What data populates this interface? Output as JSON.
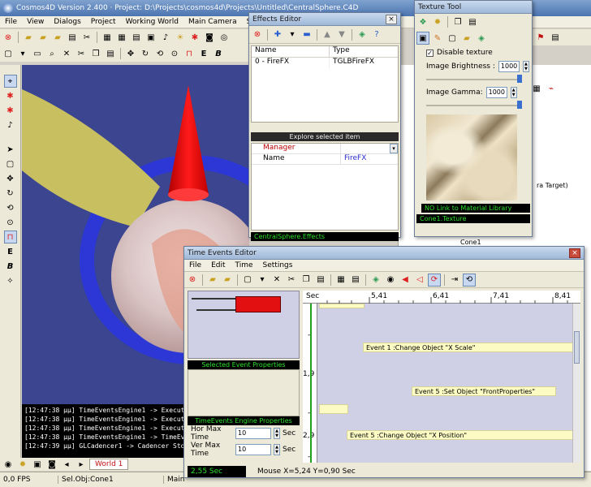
{
  "main": {
    "title": "Cosmos4D Version 2.400 · Project: D:\\Projects\\cosmos4d\\Projects\\Untitled\\CentralSphere.C4D",
    "menu": [
      "File",
      "View",
      "Dialogs",
      "Project",
      "Working World",
      "Main Camera",
      "Sel Ob"
    ],
    "status": {
      "fps": "0,0 FPS",
      "selection": "Sel.Obj:Cone1",
      "main_label": "Main"
    },
    "world_tab": "World 1",
    "log": [
      "[12:47:38 μμ]  TimeEventsEngine1 -> Execute Time E",
      "[12:47:38 μμ]  TimeEventsEngine1 -> Execute Time E",
      "[12:47:38 μμ]  TimeEventsEngine1 -> Execute Time E",
      "[12:47:38 μμ]  TimeEventsEngine1 -> TimeEvents En",
      "[12:47:39 μμ]  GLCadencer1 -> Cadencer Stop"
    ],
    "side_fragments": [
      "ra Target)",
      "Cone1"
    ]
  },
  "effects": {
    "title": "Effects Editor",
    "columns": [
      "Name",
      "Type"
    ],
    "rows": [
      {
        "name": "0 - FireFX",
        "type": "TGLBFireFX"
      }
    ],
    "explore_header": "Explore selected item",
    "props": [
      {
        "name": "Manager",
        "value": ""
      },
      {
        "name": "Name",
        "value": "FireFX"
      }
    ],
    "footer": "CentralSphere.Effects"
  },
  "texture": {
    "title": "Texture Tool",
    "disable_label": "Disable texture",
    "brightness_label": "Image Brightness :",
    "brightness_value": "1000",
    "gamma_label": "Image Gamma:",
    "gamma_value": "1000",
    "link_status": "NO Link to Material Library",
    "footer": "Cone1.Texture"
  },
  "time_events": {
    "title": "Time Events Editor",
    "menu": [
      "File",
      "Edit",
      "Time",
      "Settings"
    ],
    "ruler": {
      "label": "Sec",
      "ticks": [
        "5,41",
        "6,41",
        "7,41",
        "8,41"
      ]
    },
    "y_labels": [
      "-",
      "1,9",
      "-",
      "2,9",
      "-"
    ],
    "events": [
      {
        "label": "Event 1 :Change Object \"X Scale\""
      },
      {
        "label": "Event 5 :Set Object \"FrontProperties\""
      },
      {
        "label": "Event 5 :Change Object \"X Position\""
      }
    ],
    "selected_props_header": "Selected Event Properties",
    "engine_props_header": "TimeEvents Engine Properties",
    "hor_max_label": "Hor Max Time",
    "hor_max_value": "10",
    "ver_max_label": "Ver Max Time",
    "ver_max_value": "10",
    "unit": "Sec",
    "time_display": "2,55 Sec",
    "mouse_status": "Mouse X=5,24 Y=0,90 Sec"
  },
  "colors": {
    "accent": "#2de02d",
    "viewport_bg": "#3b4590",
    "event_fill": "#fdfbc4",
    "timeline_bg": "#cfcfe6"
  }
}
